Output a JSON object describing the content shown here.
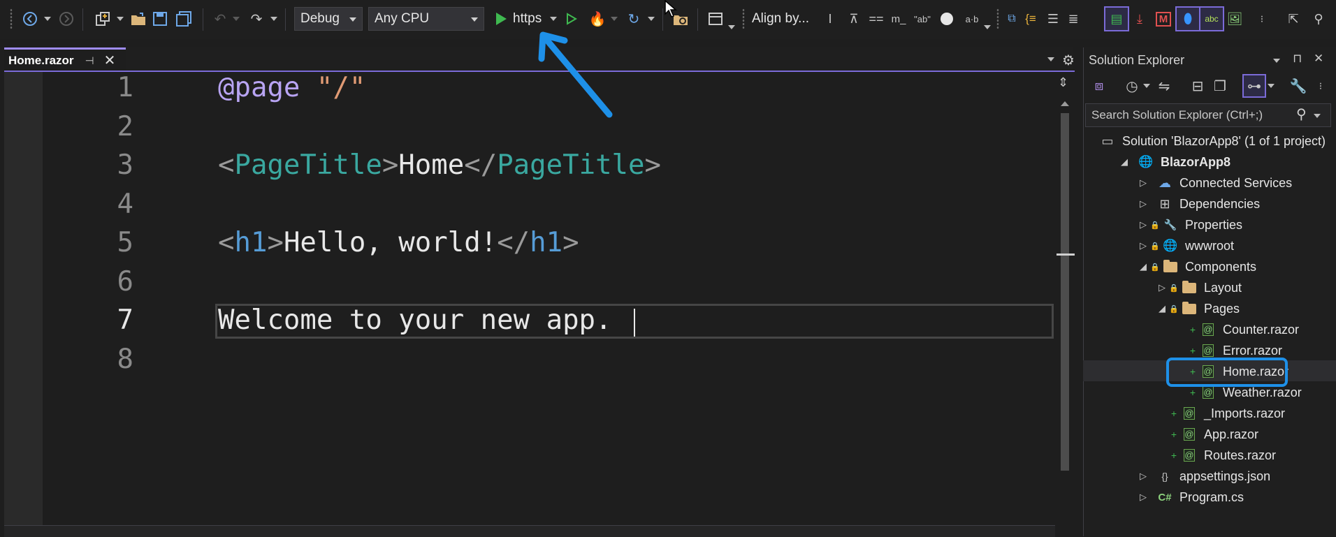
{
  "toolbar": {
    "config": "Debug",
    "platform": "Any CPU",
    "run_target": "https",
    "align_label": "Align by..."
  },
  "tab": {
    "title": "Home.razor",
    "pin_glyph": "⊣",
    "close_glyph": "✕"
  },
  "editor": {
    "line_numbers": [
      "1",
      "2",
      "3",
      "4",
      "5",
      "6",
      "7",
      "8"
    ],
    "current_line": 7,
    "lines": [
      [
        {
          "t": "@page",
          "c": "dir"
        },
        {
          "t": " ",
          "c": "txt"
        },
        {
          "t": "\"/\"",
          "c": "str"
        }
      ],
      [],
      [
        {
          "t": "<",
          "c": "br"
        },
        {
          "t": "PageTitle",
          "c": "tag"
        },
        {
          "t": ">",
          "c": "br"
        },
        {
          "t": "Home",
          "c": "txt"
        },
        {
          "t": "</",
          "c": "br"
        },
        {
          "t": "PageTitle",
          "c": "tag"
        },
        {
          "t": ">",
          "c": "br"
        }
      ],
      [],
      [
        {
          "t": "<",
          "c": "br"
        },
        {
          "t": "h1",
          "c": "h1"
        },
        {
          "t": ">",
          "c": "br"
        },
        {
          "t": "Hello, world!",
          "c": "txt"
        },
        {
          "t": "</",
          "c": "br"
        },
        {
          "t": "h1",
          "c": "h1"
        },
        {
          "t": ">",
          "c": "br"
        }
      ],
      [],
      [
        {
          "t": "Welcome to your new app.",
          "c": "txt"
        }
      ],
      []
    ]
  },
  "solution_explorer": {
    "title": "Solution Explorer",
    "search_placeholder": "Search Solution Explorer (Ctrl+;)",
    "tree": [
      {
        "label": "Solution 'BlazorApp8' (1 of 1 project)",
        "depth": 0,
        "expander": "none",
        "icon": "solution-icon",
        "bold": false
      },
      {
        "label": "BlazorApp8",
        "depth": 1,
        "expander": "open",
        "icon": "web-project-icon",
        "bold": true
      },
      {
        "label": "Connected Services",
        "depth": 2,
        "expander": "closed",
        "icon": "connected-services-icon"
      },
      {
        "label": "Dependencies",
        "depth": 2,
        "expander": "closed",
        "icon": "dependencies-icon"
      },
      {
        "label": "Properties",
        "depth": 2,
        "expander": "closed",
        "icon": "wrench-icon",
        "lock": true
      },
      {
        "label": "wwwroot",
        "depth": 2,
        "expander": "closed",
        "icon": "globe-icon",
        "lock": true
      },
      {
        "label": "Components",
        "depth": 2,
        "expander": "open",
        "icon": "folder-icon",
        "lock": true
      },
      {
        "label": "Layout",
        "depth": 3,
        "expander": "closed",
        "icon": "folder-icon",
        "lock": true
      },
      {
        "label": "Pages",
        "depth": 3,
        "expander": "open",
        "icon": "folder-icon",
        "lock": true
      },
      {
        "label": "Counter.razor",
        "depth": 4,
        "expander": "none",
        "icon": "razor-file-icon",
        "plus": true
      },
      {
        "label": "Error.razor",
        "depth": 4,
        "expander": "none",
        "icon": "razor-file-icon",
        "plus": true
      },
      {
        "label": "Home.razor",
        "depth": 4,
        "expander": "none",
        "icon": "razor-file-icon",
        "plus": true,
        "selected": true
      },
      {
        "label": "Weather.razor",
        "depth": 4,
        "expander": "none",
        "icon": "razor-file-icon",
        "plus": true
      },
      {
        "label": "_Imports.razor",
        "depth": 3,
        "expander": "none",
        "icon": "razor-file-icon",
        "plus": true
      },
      {
        "label": "App.razor",
        "depth": 3,
        "expander": "none",
        "icon": "razor-file-icon",
        "plus": true
      },
      {
        "label": "Routes.razor",
        "depth": 3,
        "expander": "none",
        "icon": "razor-file-icon",
        "plus": true
      },
      {
        "label": "appsettings.json",
        "depth": 2,
        "expander": "closed",
        "icon": "json-file-icon"
      },
      {
        "label": "Program.cs",
        "depth": 2,
        "expander": "closed",
        "icon": "csharp-file-icon"
      }
    ]
  },
  "glyphs": {
    "razor": "@",
    "csharp": "C#",
    "json": "{}",
    "textcase": "abc"
  },
  "colors": {
    "accent": "#7b6bd8",
    "annotation": "#1e90e8",
    "run_green": "#3fb950"
  }
}
